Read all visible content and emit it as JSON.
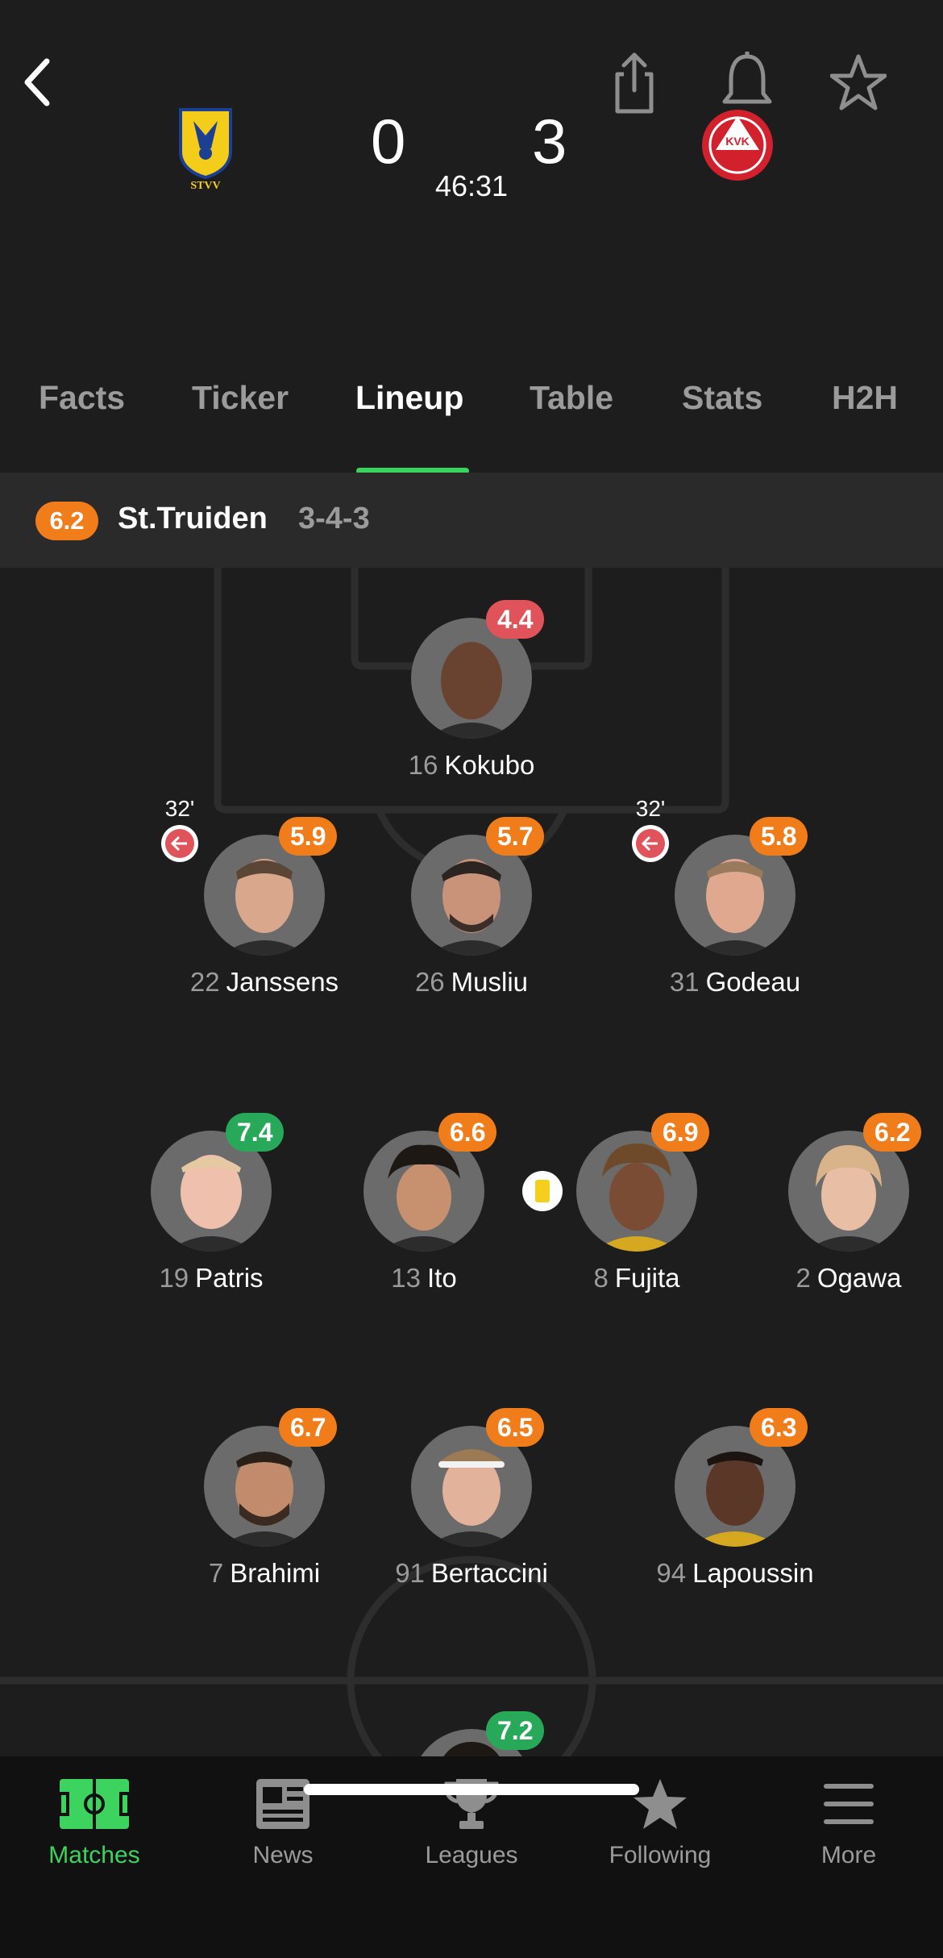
{
  "match": {
    "home_score": "0",
    "away_score": "3",
    "clock": "46:31",
    "home_crest_text": "STVV",
    "away_crest_text": "KVK"
  },
  "tabs": [
    "Facts",
    "Ticker",
    "Lineup",
    "Table",
    "Stats",
    "H2H"
  ],
  "active_tab": "Lineup",
  "team": {
    "rating": "6.2",
    "name": "St.Truiden",
    "formation": "3-4-3"
  },
  "players": [
    {
      "number": "16",
      "name": "Kokubo",
      "rating": "4.4",
      "rating_color": "red"
    },
    {
      "number": "22",
      "name": "Janssens",
      "rating": "5.9",
      "rating_color": "orange",
      "sub_time": "32'"
    },
    {
      "number": "26",
      "name": "Musliu",
      "rating": "5.7",
      "rating_color": "orange"
    },
    {
      "number": "31",
      "name": "Godeau",
      "rating": "5.8",
      "rating_color": "orange",
      "sub_time": "32'"
    },
    {
      "number": "19",
      "name": "Patris",
      "rating": "7.4",
      "rating_color": "green"
    },
    {
      "number": "13",
      "name": "Ito",
      "rating": "6.6",
      "rating_color": "orange"
    },
    {
      "number": "8",
      "name": "Fujita",
      "rating": "6.9",
      "rating_color": "orange",
      "yellow_card": true
    },
    {
      "number": "2",
      "name": "Ogawa",
      "rating": "6.2",
      "rating_color": "orange"
    },
    {
      "number": "7",
      "name": "Brahimi",
      "rating": "6.7",
      "rating_color": "orange"
    },
    {
      "number": "91",
      "name": "Bertaccini",
      "rating": "6.5",
      "rating_color": "orange"
    },
    {
      "number": "94",
      "name": "Lapoussin",
      "rating": "6.3",
      "rating_color": "orange"
    },
    {
      "number": "",
      "name": "",
      "rating": "7.2",
      "rating_color": "green"
    }
  ],
  "nav": {
    "items": [
      "Matches",
      "News",
      "Leagues",
      "Following",
      "More"
    ],
    "active": "Matches"
  },
  "colors": {
    "accent": "#3cd35e",
    "rating_orange": "#f07c1a",
    "rating_green": "#28a959",
    "rating_red": "#e0535a"
  }
}
